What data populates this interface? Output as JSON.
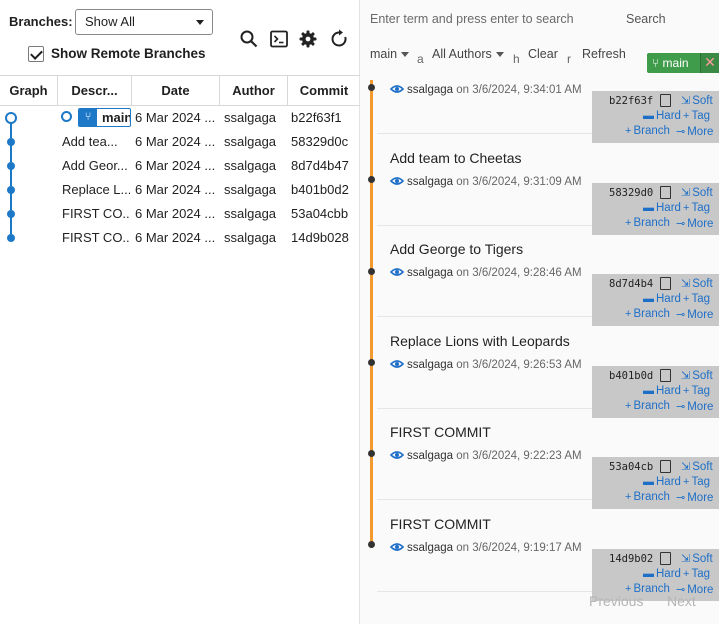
{
  "left": {
    "branches_label": "Branches:",
    "branch_select_value": "Show All",
    "show_remote_label": "Show Remote Branches",
    "show_remote_checked": true,
    "toolbar_icons": [
      "search-icon",
      "terminal-icon",
      "gear-icon",
      "refresh-icon"
    ],
    "columns": [
      "Graph",
      "Descr...",
      "Date",
      "Author",
      "Commit"
    ],
    "rows": [
      {
        "description": "main",
        "date": "6 Mar 2024 ...",
        "author": "ssalgaga",
        "commit": "b22f63f1"
      },
      {
        "description": "Add tea...",
        "date": "6 Mar 2024 ...",
        "author": "ssalgaga",
        "commit": "58329d0c"
      },
      {
        "description": "Add Geor...",
        "date": "6 Mar 2024 ...",
        "author": "ssalgaga",
        "commit": "8d7d4b47"
      },
      {
        "description": "Replace L...",
        "date": "6 Mar 2024 ...",
        "author": "ssalgaga",
        "commit": "b401b0d2"
      },
      {
        "description": "FIRST CO...",
        "date": "6 Mar 2024 ...",
        "author": "ssalgaga",
        "commit": "53a04cbb"
      },
      {
        "description": "FIRST CO...",
        "date": "6 Mar 2024 ...",
        "author": "ssalgaga",
        "commit": "14d9b028"
      }
    ]
  },
  "right": {
    "search_placeholder": "Enter term and press enter to search",
    "search_button": "Search",
    "branch_filter": "main",
    "author_filter": "All Authors",
    "clear_label": "Clear",
    "refresh_label": "Refresh",
    "stray_chars": [
      "a",
      "h",
      "r"
    ],
    "active_branch_label": "main",
    "active_branch_close": "✕",
    "on_word": "on",
    "commits": [
      {
        "title": "",
        "author": "ssalgaga",
        "datetime": "3/6/2024, 9:34:01 AM",
        "sha": "b22f63f"
      },
      {
        "title": "Add team to Cheetas",
        "author": "ssalgaga",
        "datetime": "3/6/2024, 9:31:09 AM",
        "sha": "58329d0"
      },
      {
        "title": "Add George to Tigers",
        "author": "ssalgaga",
        "datetime": "3/6/2024, 9:28:46 AM",
        "sha": "8d7d4b4"
      },
      {
        "title": "Replace Lions with Leopards",
        "author": "ssalgaga",
        "datetime": "3/6/2024, 9:26:53 AM",
        "sha": "b401b0d"
      },
      {
        "title": "FIRST COMMIT",
        "author": "ssalgaga",
        "datetime": "3/6/2024, 9:22:23 AM",
        "sha": "53a04cb"
      },
      {
        "title": "FIRST COMMIT",
        "author": "ssalgaga",
        "datetime": "3/6/2024, 9:19:17 AM",
        "sha": "14d9b02"
      }
    ],
    "actions": {
      "soft": "Soft",
      "hard": "Hard",
      "tag": "Tag",
      "branch": "Branch",
      "more": "More"
    },
    "pager": {
      "previous": "Previous",
      "next": "Next"
    }
  },
  "colors": {
    "accent_blue": "#1e78c8",
    "timeline_orange": "#f29a2e",
    "branch_green": "#3f9c4b",
    "action_panel": "#c8c8c8"
  }
}
